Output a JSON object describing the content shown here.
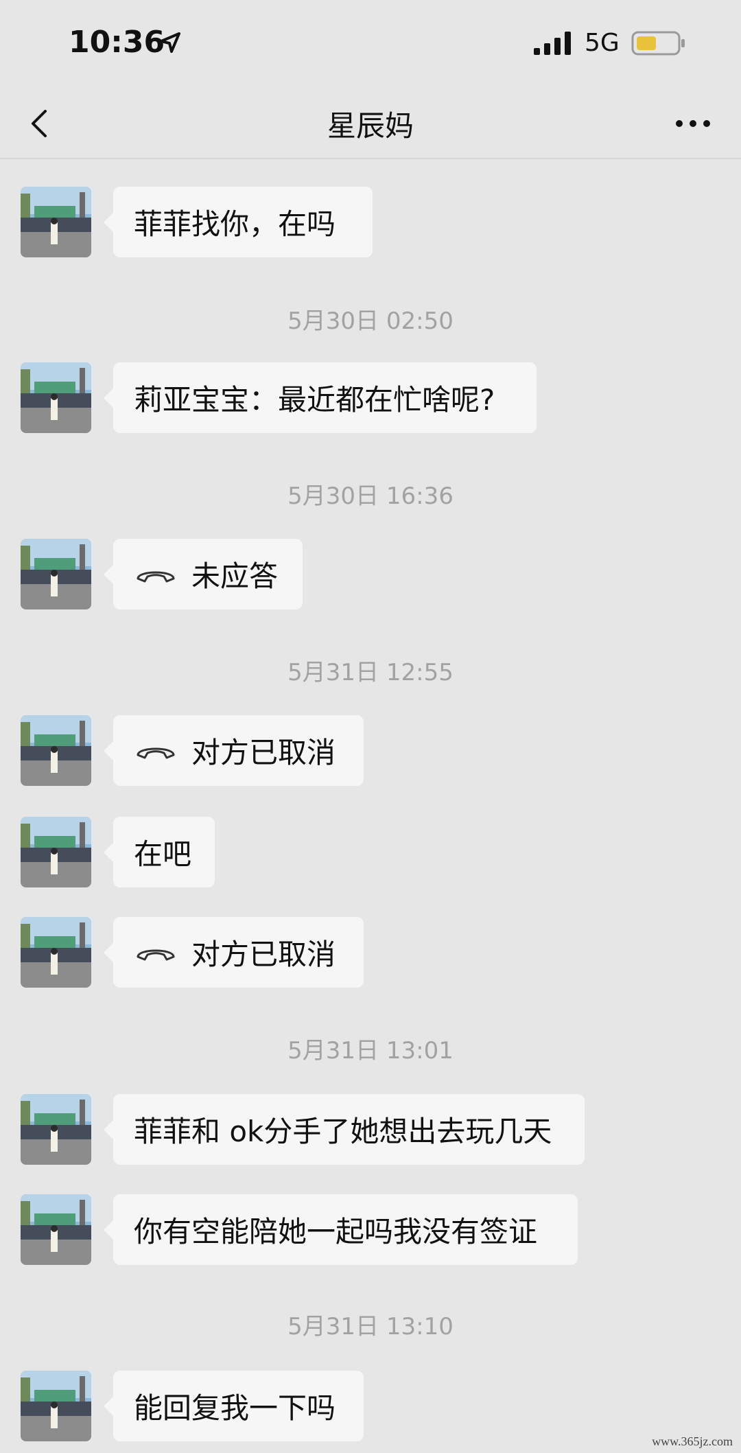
{
  "status_bar": {
    "time": "10:36",
    "network": "5G",
    "icons": [
      "location-arrow-icon",
      "signal-icon",
      "battery-icon"
    ],
    "battery_color": "#e8c33a"
  },
  "nav": {
    "title": "星辰妈",
    "back_icon": "chevron-left-icon",
    "more_icon": "more-dots-icon"
  },
  "messages": [
    {
      "type": "text",
      "text": "菲菲找你，在吗"
    },
    {
      "type": "time",
      "text": "5月30日 02:50"
    },
    {
      "type": "text",
      "text": "莉亚宝宝：最近都在忙啥呢?"
    },
    {
      "type": "time",
      "text": "5月30日 16:36"
    },
    {
      "type": "call",
      "text": "未应答",
      "icon": "phone-hangup-icon"
    },
    {
      "type": "time",
      "text": "5月31日 12:55"
    },
    {
      "type": "call",
      "text": "对方已取消",
      "icon": "phone-hangup-icon"
    },
    {
      "type": "text",
      "text": "在吧"
    },
    {
      "type": "call",
      "text": "对方已取消",
      "icon": "phone-hangup-icon"
    },
    {
      "type": "time",
      "text": "5月31日 13:01"
    },
    {
      "type": "text",
      "text": "菲菲和 ok分手了她想出去玩几天"
    },
    {
      "type": "text",
      "text": "你有空能陪她一起吗我没有签证"
    },
    {
      "type": "time",
      "text": "5月31日 13:10"
    },
    {
      "type": "text",
      "text": "能回复我一下吗"
    }
  ],
  "watermark": "www.365jz.com",
  "colors": {
    "background": "#e6e6e6",
    "bubble": "#f6f6f6",
    "timestamp": "#a2a2a2"
  }
}
